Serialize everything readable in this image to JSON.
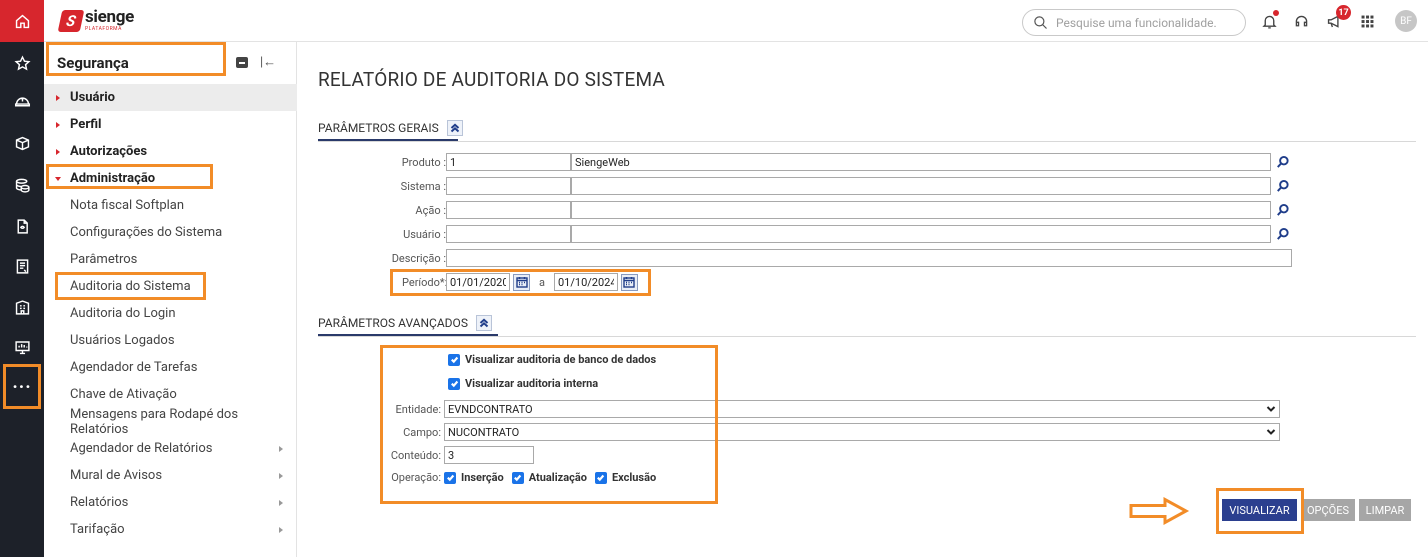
{
  "app": {
    "brand_name": "sienge",
    "brand_sub": "PLATAFORMA",
    "colors": {
      "brand": "#d7262d",
      "primary_button": "#2b3f8f",
      "highlight": "#f28c28",
      "rail": "#1d2129"
    }
  },
  "rail": {
    "items": [
      {
        "icon": "home-icon"
      },
      {
        "icon": "star-icon"
      },
      {
        "icon": "helmet-icon"
      },
      {
        "icon": "box-icon"
      },
      {
        "icon": "coins-icon"
      },
      {
        "icon": "document-icon"
      },
      {
        "icon": "report-icon"
      },
      {
        "icon": "building-icon"
      },
      {
        "icon": "monitor-icon"
      },
      {
        "icon": "more-icon",
        "label": "···"
      }
    ]
  },
  "topbar": {
    "search_placeholder": "Pesquise uma funcionalidade.",
    "announcements_count": "17",
    "avatar_initials": "BF"
  },
  "sidebar": {
    "title": "Segurança",
    "groups": [
      {
        "label": "Usuário",
        "expanded": false
      },
      {
        "label": "Perfil",
        "expanded": false
      },
      {
        "label": "Autorizações",
        "expanded": false
      },
      {
        "label": "Administração",
        "expanded": true
      }
    ],
    "items": [
      {
        "label": "Nota fiscal Softplan"
      },
      {
        "label": "Configurações do Sistema"
      },
      {
        "label": "Parâmetros"
      },
      {
        "label": "Auditoria do Sistema"
      },
      {
        "label": "Auditoria do Login"
      },
      {
        "label": "Usuários Logados"
      },
      {
        "label": "Agendador de Tarefas"
      },
      {
        "label": "Chave de Ativação"
      },
      {
        "label": "Mensagens para Rodapé dos Relatórios"
      },
      {
        "label": "Agendador de Relatórios"
      },
      {
        "label": "Mural de Avisos"
      },
      {
        "label": "Relatórios"
      },
      {
        "label": "Tarifação"
      }
    ]
  },
  "main": {
    "title": "RELATÓRIO DE AUDITORIA DO SISTEMA",
    "general": {
      "section_title": "PARÂMETROS GERAIS",
      "produto_label": "Produto :",
      "produto_code": "1",
      "produto_name": "SiengeWeb",
      "sistema_label": "Sistema :",
      "acao_label": "Ação :",
      "usuario_label": "Usuário :",
      "descricao_label": "Descrição :",
      "periodo_label": "Período*:",
      "periodo_start": "01/01/2020",
      "periodo_sep": "a",
      "periodo_end": "01/10/2024"
    },
    "advanced": {
      "section_title": "PARÂMETROS AVANÇADOS",
      "chk_db": "Visualizar auditoria de banco de dados",
      "chk_internal": "Visualizar auditoria interna",
      "entidade_label": "Entidade:",
      "entidade_value": "EVNDCONTRATO",
      "campo_label": "Campo:",
      "campo_value": "NUCONTRATO",
      "conteudo_label": "Conteúdo:",
      "conteudo_value": "3",
      "operacao_label": "Operação:",
      "op_insert": "Inserção",
      "op_update": "Atualização",
      "op_delete": "Exclusão"
    },
    "buttons": {
      "visualizar": "VISUALIZAR",
      "opcoes": "OPÇÕES",
      "limpar": "LIMPAR"
    }
  }
}
